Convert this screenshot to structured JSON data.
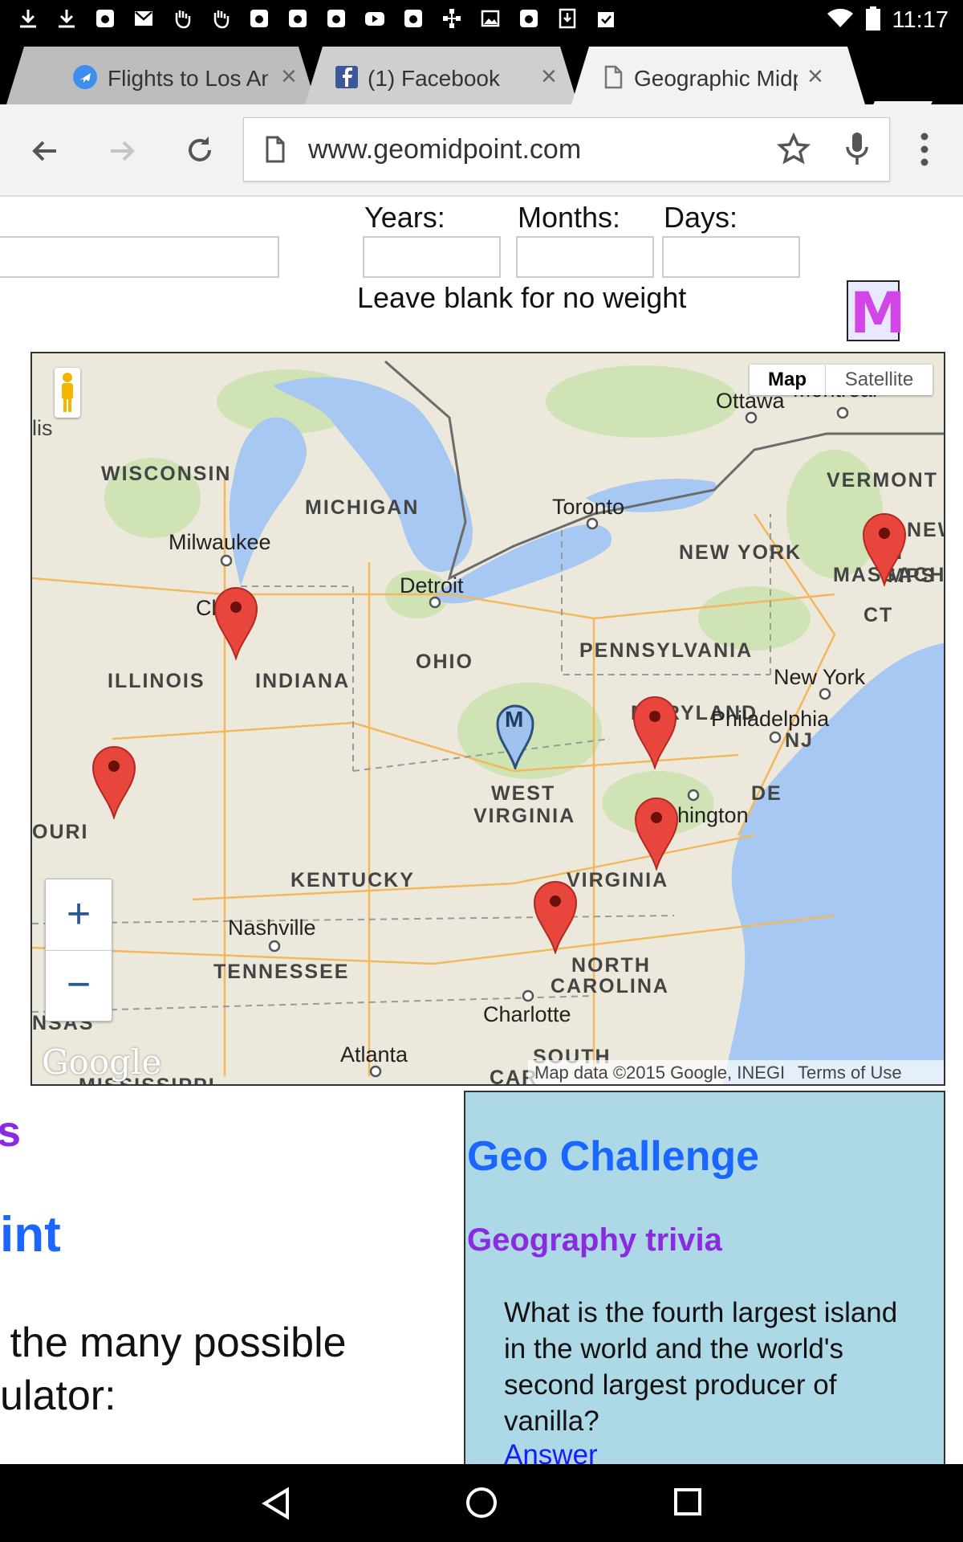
{
  "status_bar": {
    "time": "11:17",
    "notification_icons": [
      "download-icon",
      "download-icon",
      "instagram-icon",
      "gmail-icon",
      "hand-icon",
      "hand-icon",
      "instagram-icon",
      "instagram-icon",
      "instagram-icon",
      "youtube-icon",
      "instagram-icon",
      "tree-icon",
      "image-icon",
      "instagram-icon",
      "download-icon",
      "clipboard-icon"
    ]
  },
  "tabs": [
    {
      "title": "Flights to Los An",
      "icon": "plane-icon"
    },
    {
      "title": "(1) Facebook",
      "icon": "facebook-icon"
    },
    {
      "title": "Geographic Midp",
      "icon": "page-icon"
    }
  ],
  "toolbar": {
    "url": "www.geomidpoint.com"
  },
  "form": {
    "years_label": "Years:",
    "months_label": "Months:",
    "days_label": "Days:",
    "hint": "Leave blank for no weight",
    "logo_letter": "M"
  },
  "map": {
    "map_button": "Map",
    "satellite_button": "Satellite",
    "zoom_in": "+",
    "zoom_out": "−",
    "attribution": "Map data ©2015 Google, INEGI",
    "terms": "Terms of Use",
    "logo": "Google",
    "midpoint_marker_label": "M",
    "region_labels": [
      {
        "text": "WISCONSIN"
      },
      {
        "text": "MICHIGAN"
      },
      {
        "text": "NEW YORK"
      },
      {
        "text": "VERMONT"
      },
      {
        "text": "MASSACH"
      },
      {
        "text": "CT"
      },
      {
        "text": "PENNSYLVANIA"
      },
      {
        "text": "OHIO"
      },
      {
        "text": "ILLINOIS"
      },
      {
        "text": "INDIANA"
      },
      {
        "text": "MARYLAND"
      },
      {
        "text": "NJ"
      },
      {
        "text": "DE"
      },
      {
        "text": "WEST"
      },
      {
        "text": "VIRGINIA"
      },
      {
        "text": "VIRGINIA"
      },
      {
        "text": "KENTUCKY"
      },
      {
        "text": "TENNESSEE"
      },
      {
        "text": "NORTH"
      },
      {
        "text": "CAROLINA"
      },
      {
        "text": "SOUTH"
      },
      {
        "text": "CAR"
      },
      {
        "text": "OURI"
      },
      {
        "text": "NSAS"
      },
      {
        "text": "MISSISSIPPI"
      },
      {
        "text": "NEW"
      },
      {
        "text": "H MPS"
      },
      {
        "text": "lis"
      }
    ],
    "city_labels": [
      {
        "text": "Ottawa"
      },
      {
        "text": "Montreal"
      },
      {
        "text": "Toronto"
      },
      {
        "text": "Milwaukee"
      },
      {
        "text": "Detroit"
      },
      {
        "text": "Ch   go"
      },
      {
        "text": "New York"
      },
      {
        "text": "Philadelphia"
      },
      {
        "text": "hington"
      },
      {
        "text": "Nashville"
      },
      {
        "text": "Charlotte"
      },
      {
        "text": "Atlanta"
      }
    ]
  },
  "content": {
    "partial_heading_1": "s",
    "partial_heading_2": "int",
    "partial_text_1": " the many possible",
    "partial_text_2": "ulator:"
  },
  "geo_challenge": {
    "title": "Geo Challenge",
    "subtitle": "Geography trivia",
    "question": "What is the fourth largest island in the world and the world's second largest producer of vanilla?",
    "answer_link": "Answer"
  },
  "colors": {
    "link_blue": "#1a66ff",
    "trivia_purple": "#8a2be2",
    "panel_bg": "#add8e6",
    "marker_red": "#e8463c"
  }
}
